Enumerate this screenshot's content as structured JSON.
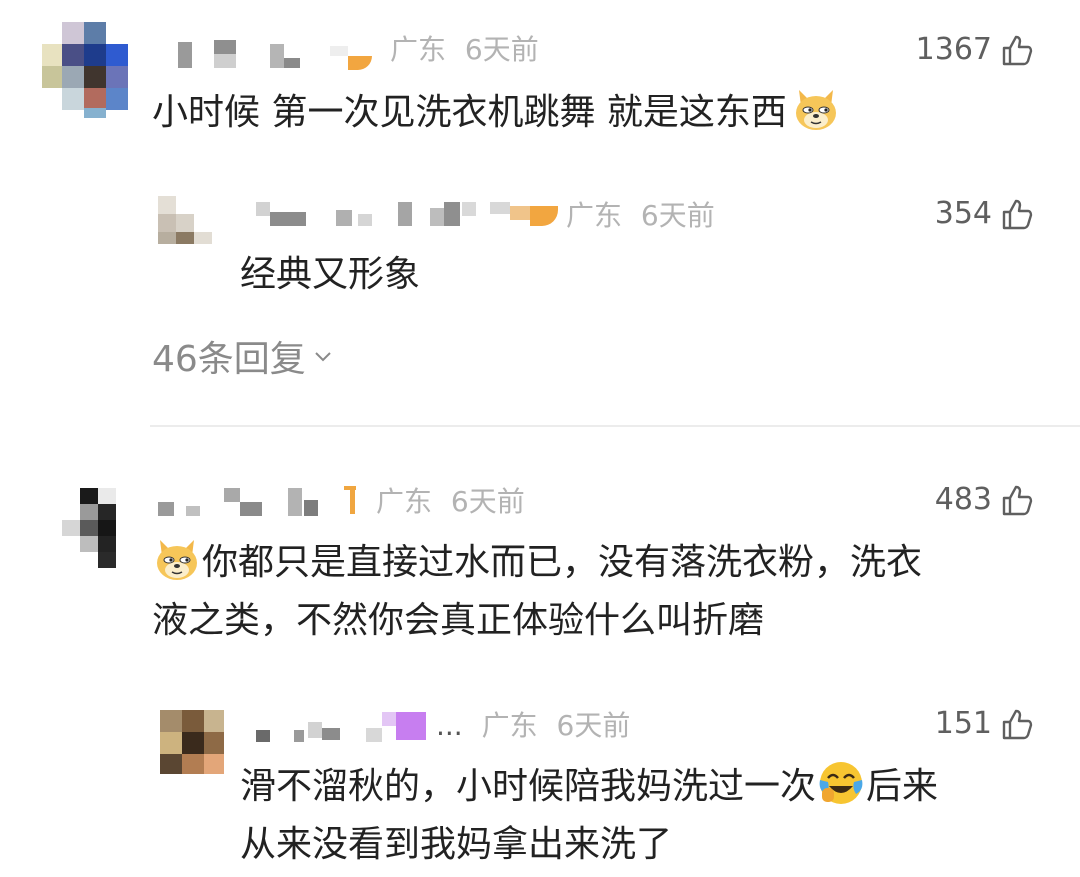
{
  "comments": [
    {
      "location": "广东",
      "time": "6天前",
      "likes": "1367",
      "text": "小时候 第一次见洗衣机跳舞 就是这东西",
      "emoji": "doge-emoji",
      "reply": {
        "location": "广东",
        "time": "6天前",
        "likes": "354",
        "text": "经典又形象"
      },
      "replies_label": "46条回复"
    },
    {
      "location": "广东",
      "time": "6天前",
      "likes": "483",
      "emoji": "doge-emoji",
      "text_line1": "你都只是直接过水而已，没有落洗衣粉，洗衣",
      "text_line2": "液之类，不然你会真正体验什么叫折磨",
      "reply": {
        "name_suffix": "...",
        "location": "广东",
        "time": "6天前",
        "likes": "151",
        "text_line1a": "滑不溜秋的，小时候陪我妈洗过一次",
        "emoji": "laughing-crying-emoji",
        "text_line1b": "后来",
        "text_line2": "从来没看到我妈拿出来洗了"
      }
    }
  ],
  "colors": {
    "meta": "#b3b3b3",
    "body": "#222222",
    "likes": "#5f5f5f",
    "divider": "#ececec"
  }
}
